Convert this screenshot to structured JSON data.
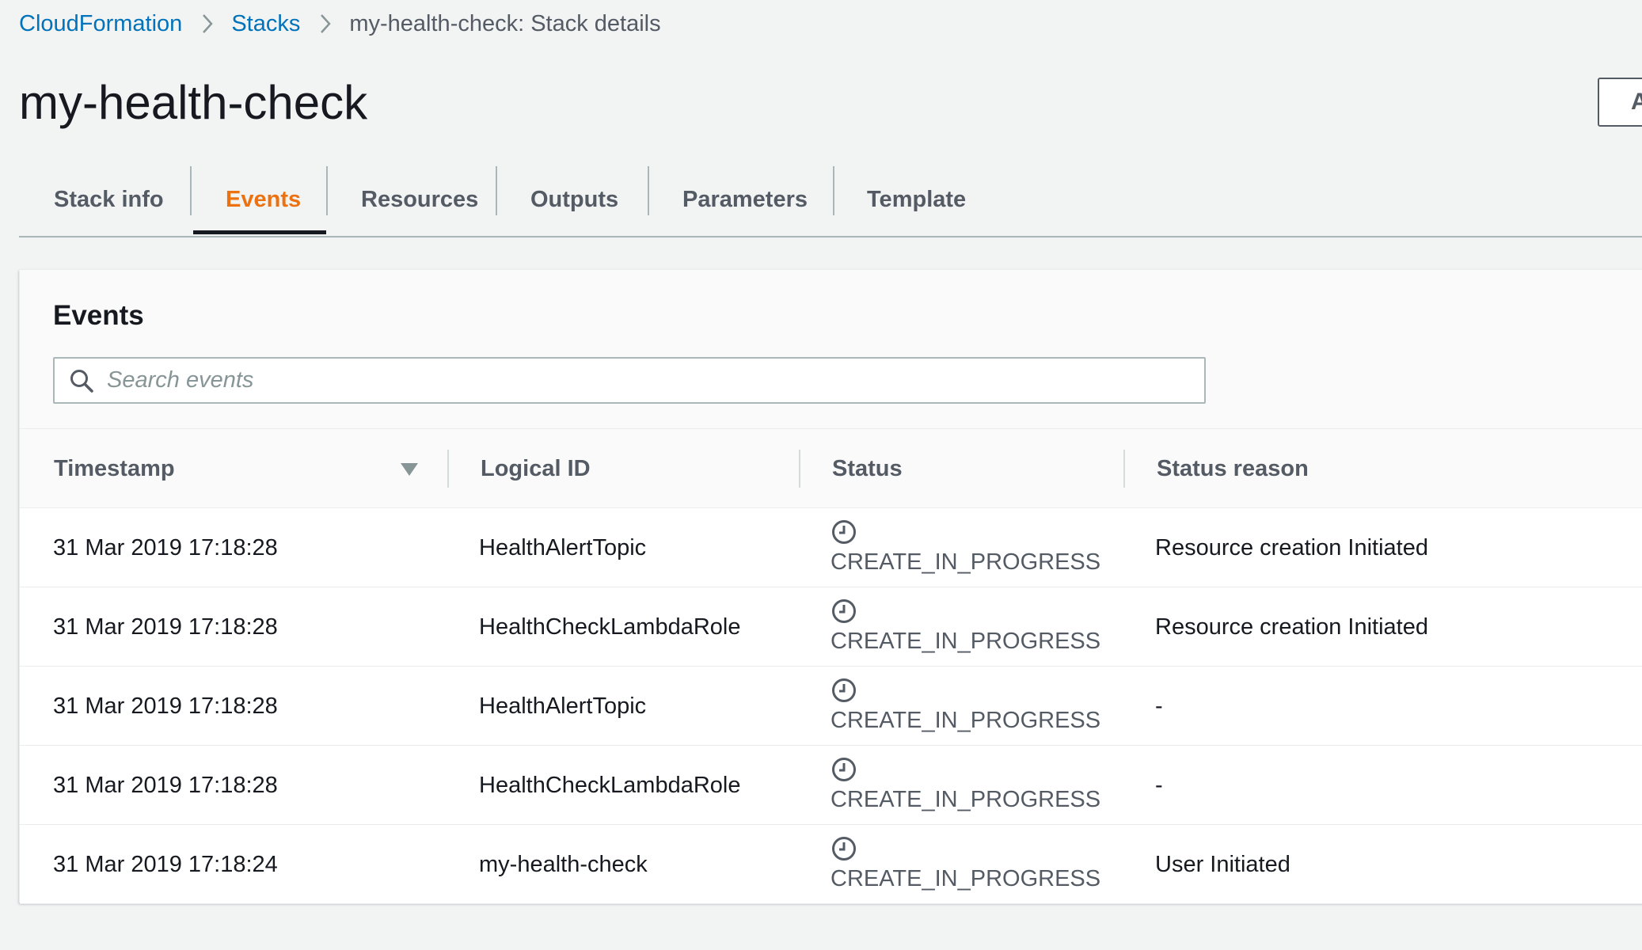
{
  "breadcrumb": {
    "root": "CloudFormation",
    "section": "Stacks",
    "current": "my-health-check: Stack details"
  },
  "page": {
    "title": "my-health-check",
    "action_label": "Actions"
  },
  "tabs": [
    {
      "label": "Stack info",
      "active": false
    },
    {
      "label": "Events",
      "active": true
    },
    {
      "label": "Resources",
      "active": false
    },
    {
      "label": "Outputs",
      "active": false
    },
    {
      "label": "Parameters",
      "active": false
    },
    {
      "label": "Template",
      "active": false
    }
  ],
  "events_panel": {
    "title": "Events",
    "search_placeholder": "Search events",
    "columns": {
      "timestamp": "Timestamp",
      "logical_id": "Logical ID",
      "status": "Status",
      "status_reason": "Status reason"
    },
    "rows": [
      {
        "timestamp": "31 Mar 2019 17:18:28",
        "logical_id": "HealthAlertTopic",
        "status": "CREATE_IN_PROGRESS",
        "status_reason": "Resource creation Initiated"
      },
      {
        "timestamp": "31 Mar 2019 17:18:28",
        "logical_id": "HealthCheckLambdaRole",
        "status": "CREATE_IN_PROGRESS",
        "status_reason": "Resource creation Initiated"
      },
      {
        "timestamp": "31 Mar 2019 17:18:28",
        "logical_id": "HealthAlertTopic",
        "status": "CREATE_IN_PROGRESS",
        "status_reason": "-"
      },
      {
        "timestamp": "31 Mar 2019 17:18:28",
        "logical_id": "HealthCheckLambdaRole",
        "status": "CREATE_IN_PROGRESS",
        "status_reason": "-"
      },
      {
        "timestamp": "31 Mar 2019 17:18:24",
        "logical_id": "my-health-check",
        "status": "CREATE_IN_PROGRESS",
        "status_reason": "User Initiated"
      }
    ]
  },
  "icons": {
    "breadcrumb_separator": "chevron-right-icon",
    "search": "search-icon",
    "sort": "sort-descending-icon",
    "status": "clock-icon"
  },
  "colors": {
    "link": "#0073bb",
    "active_tab": "#ec7211",
    "background": "#f2f3f3"
  }
}
